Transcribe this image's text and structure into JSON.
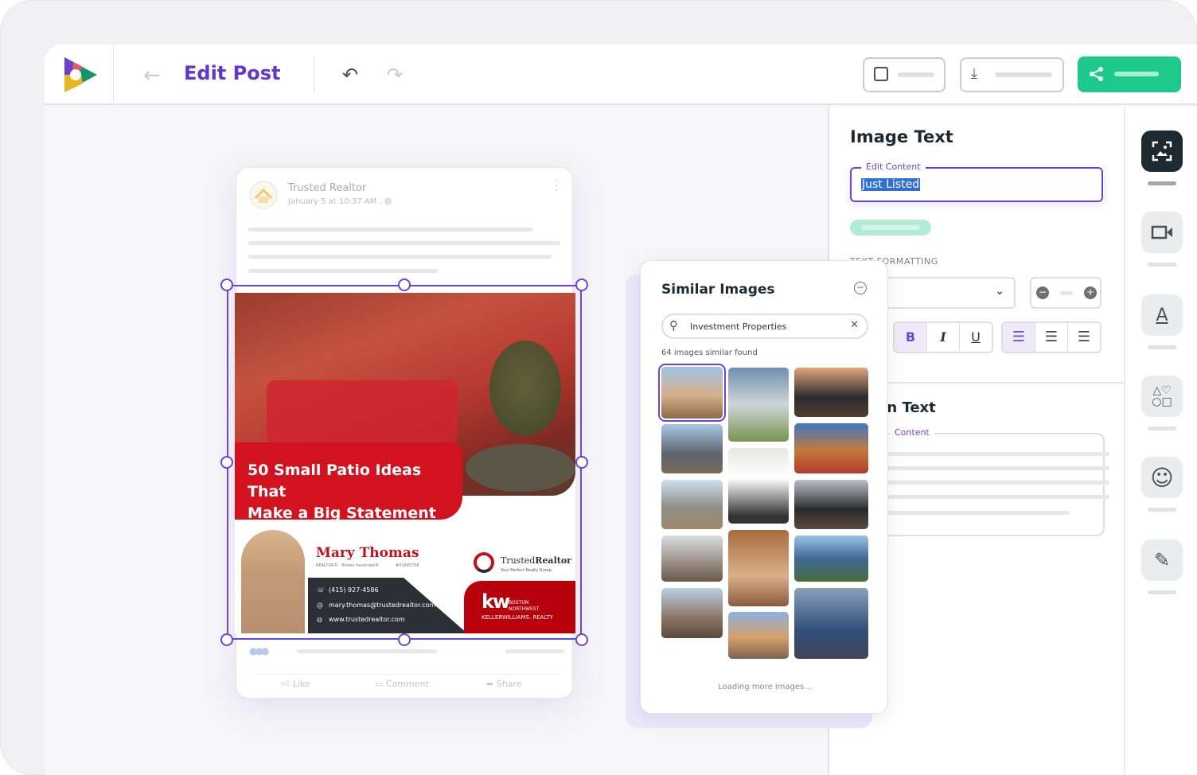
{
  "header": {
    "title": "Edit Post"
  },
  "post": {
    "author": "Trusted Realtor",
    "timestamp": "January 5 at 10:37 AM .",
    "image": {
      "headline_line1": "50 Small Patio Ideas That",
      "headline_line2": "Make a Big Statement",
      "agent_name": "Mary Thomas",
      "agent_title": "REALTOR® · Broker Associate®",
      "agent_license": "#01845706",
      "phone": "(415) 927-4586",
      "email": "mary.thomas@trustedrealtor.com",
      "website": "www.trustedrealtor.com",
      "brand_name_a": "Trusted",
      "brand_name_b": "Realtor",
      "brand_tagline": "Your Perfect Realty Group",
      "kw_mark": "kw",
      "kw_office_1": "BOSTON",
      "kw_office_2": "NORTHWEST",
      "kw_name": "KELLERWILLIAMS. REALTY"
    },
    "actions": {
      "like": "Like",
      "comment": "Comment",
      "share": "Share"
    }
  },
  "similar_images": {
    "title": "Similar Images",
    "search_value": "Investment Properties",
    "count_text": "64 images similar found",
    "loading_text": "Loading more images..."
  },
  "panel": {
    "section_title": "Image Text",
    "field_label": "Edit Content",
    "field_value": "Just Listed",
    "formatting_label": "TEXT FORMATTING",
    "bold": "B",
    "italic": "I",
    "underline": "U",
    "section2_title": "on Text",
    "section2_field_label": "Content"
  },
  "colors": {
    "accent": "#6236d0",
    "green": "#1dc98a",
    "red": "#d0021b",
    "dark": "#1e2a32"
  },
  "rail": {
    "icons": [
      "image-text-icon",
      "video-icon",
      "text-icon",
      "shapes-icon",
      "emoji-icon",
      "draw-icon"
    ],
    "active": 0
  }
}
